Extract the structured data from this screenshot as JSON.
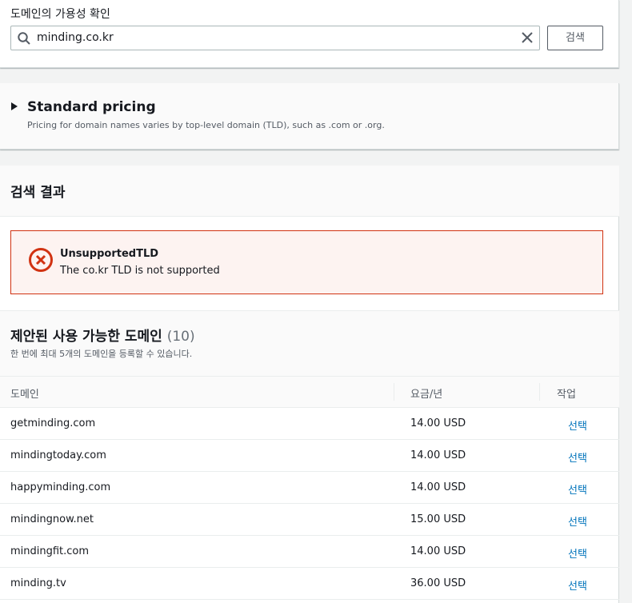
{
  "search": {
    "label": "도메인의 가용성 확인",
    "value": "minding.co.kr",
    "button": "검색"
  },
  "pricing": {
    "title": "Standard pricing",
    "description": "Pricing for domain names varies by top-level domain (TLD), such as .com or .org."
  },
  "results": {
    "title": "검색 결과"
  },
  "alert": {
    "title": "UnsupportedTLD",
    "message": "The co.kr TLD is not supported",
    "color": "#d13212"
  },
  "suggestions": {
    "title": "제안된 사용 가능한 도메인",
    "count": "(10)",
    "description": "한 번에 최대 5개의 도메인을 등록할 수 있습니다.",
    "columns": [
      "도메인",
      "요금/년",
      "작업"
    ],
    "rows": [
      {
        "domain": "getminding.com",
        "price": "14.00 USD",
        "action": "선택"
      },
      {
        "domain": "mindingtoday.com",
        "price": "14.00 USD",
        "action": "선택"
      },
      {
        "domain": "happyminding.com",
        "price": "14.00 USD",
        "action": "선택"
      },
      {
        "domain": "mindingnow.net",
        "price": "15.00 USD",
        "action": "선택"
      },
      {
        "domain": "mindingfit.com",
        "price": "14.00 USD",
        "action": "선택"
      },
      {
        "domain": "minding.tv",
        "price": "36.00 USD",
        "action": "선택"
      }
    ]
  },
  "colors": {
    "link": "#0073bb",
    "error": "#d13212"
  }
}
